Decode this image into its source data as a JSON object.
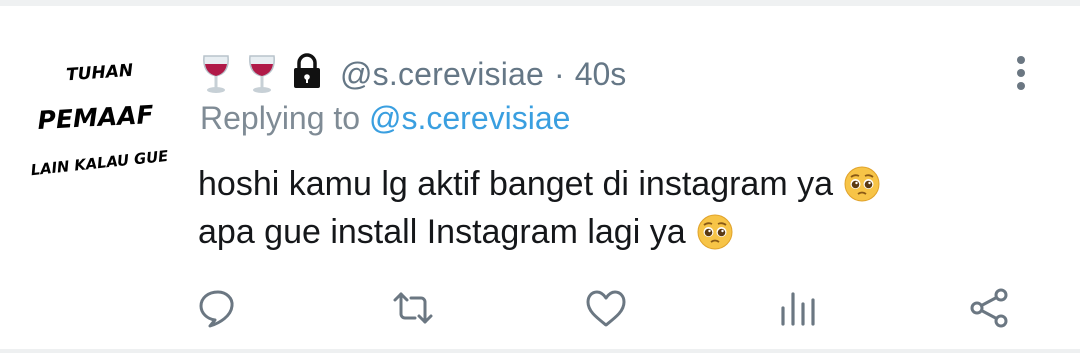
{
  "tweet": {
    "avatar_text": {
      "line1": "TUHAN",
      "line2": "PEMAAF",
      "line3": "LAIN KALAU GUE"
    },
    "header_icons": [
      "wine-glass-icon",
      "wine-glass-icon",
      "lock-icon"
    ],
    "handle": "@s.cerevisiae",
    "separator": "·",
    "time": "40s",
    "replying_prefix": "Replying to",
    "replying_handle": "@s.cerevisiae",
    "body_line1": "hoshi kamu lg aktif banget di instagram ya",
    "body_line2": "apa gue install Instagram lagi ya",
    "body_emoji": "pleading-face-icon"
  },
  "actions": [
    "reply-icon",
    "retweet-icon",
    "like-icon",
    "analytics-icon",
    "share-icon"
  ],
  "colors": {
    "handle_gray": "#657786",
    "mention_blue": "#3a9fe0",
    "icon_gray": "#6b7782",
    "text": "#15171a"
  }
}
